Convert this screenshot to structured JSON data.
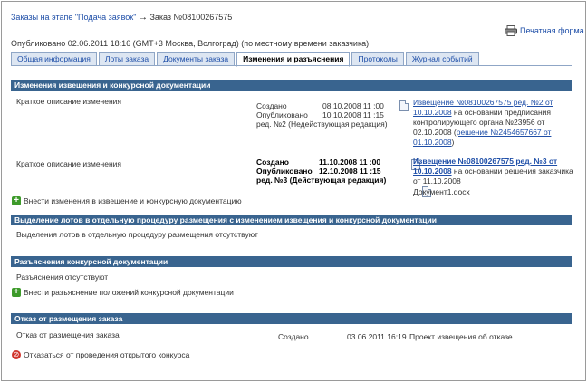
{
  "breadcrumb": {
    "stage_link": "Заказы на этапе \"Подача заявок\"",
    "arrow": "→",
    "order": "Заказ №08100267575"
  },
  "print_label": "Печатная форма",
  "published": "Опубликовано 02.06.2011 18:16 (GMT+3 Москва, Волгоград) (по местному времени заказчика)",
  "tabs": [
    {
      "label": "Общая информация",
      "active": false
    },
    {
      "label": "Лоты заказа",
      "active": false
    },
    {
      "label": "Документы заказа",
      "active": false
    },
    {
      "label": "Изменения и разъяснения",
      "active": true
    },
    {
      "label": "Протоколы",
      "active": false
    },
    {
      "label": "Журнал событий",
      "active": false
    }
  ],
  "changes": {
    "header": "Изменения извещения и конкурсной документации",
    "rows": [
      {
        "desc": "Краткое описание изменения",
        "created_label": "Создано",
        "created": "08.10.2008 11 :00",
        "published_label": "Опубликовано",
        "published": "10.10.2008 11 :15",
        "edition": "ред. №2 (Недействующая редакция)",
        "notice_link": "Извещение №08100267575 ред. №2  от 10.10.2008",
        "notice_text": " на основании предписания контролирующего органа №23956  от 02.10.2008 (",
        "decision_link": "решение №2454657667 от 01.10.2008",
        "notice_tail": ")"
      },
      {
        "desc": "Краткое описание изменения",
        "created_label": "Создано",
        "created": "11.10.2008 11 :00",
        "published_label": "Опубликовано",
        "published": "12.10.2008 11 :15",
        "edition": "ред. №3 (Действующая редакция)",
        "notice_link": "Извещение №08100267575 ред. №3  от 10.10.2008",
        "notice_text": " на основании решения заказчика  от 11.10.2008",
        "doc_link": "Документ1.docx"
      }
    ],
    "add_action": "Внести изменения в извещение и конкурсную документацию"
  },
  "lots": {
    "header": "Выделение лотов в отдельную процедуру размещения с изменением извещения и конкурсной документации",
    "text": "Выделения лотов в отдельную процедуру размещения отсутствуют"
  },
  "clarifications": {
    "header": "Разъяснения конкурсной документации",
    "text": "Разъяснения отсутствуют",
    "add_action": "Внести разъяснение положений конкурсной документации"
  },
  "refusal": {
    "header": "Отказ от размещения заказа",
    "link": "Отказ от размещения заказа",
    "created_label": "Создано",
    "created": "03.06.2011 16:19",
    "project_link": "Проект извещения об отказе",
    "cancel_action": "Отказаться от проведения открытого конкурса"
  },
  "icons": [
    "printer-icon",
    "document-icon",
    "plus-icon",
    "stop-icon"
  ]
}
